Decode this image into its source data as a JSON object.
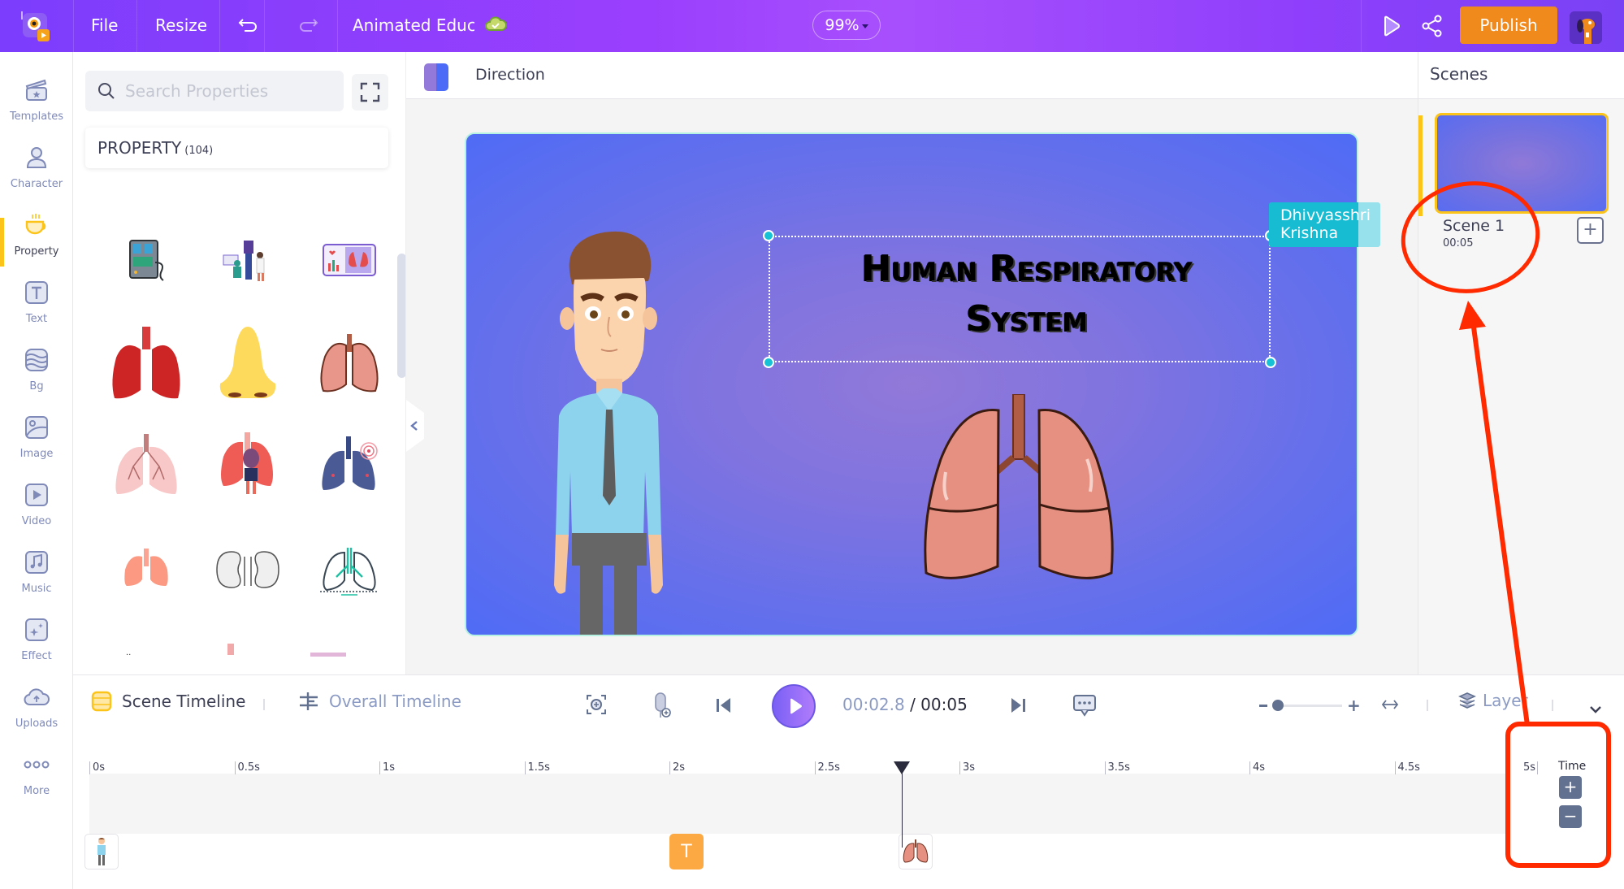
{
  "topbar": {
    "file_label": "File",
    "resize_label": "Resize",
    "project_title": "Animated Educa",
    "zoom_level": "99%",
    "publish_label": "Publish"
  },
  "rail": {
    "items": [
      {
        "label": "Templates",
        "icon": "clapperboard-star-icon"
      },
      {
        "label": "Character",
        "icon": "person-icon"
      },
      {
        "label": "Property",
        "icon": "coffee-cup-icon",
        "active": true
      },
      {
        "label": "Text",
        "icon": "text-t-icon"
      },
      {
        "label": "Bg",
        "icon": "layers-wave-icon"
      },
      {
        "label": "Image",
        "icon": "image-icon"
      },
      {
        "label": "Video",
        "icon": "play-square-icon"
      },
      {
        "label": "Music",
        "icon": "music-note-icon"
      },
      {
        "label": "Effect",
        "icon": "sparkle-icon"
      },
      {
        "label": "Uploads",
        "icon": "cloud-upload-icon"
      },
      {
        "label": "More",
        "icon": "more-dots-icon"
      }
    ]
  },
  "panel": {
    "search_placeholder": "Search Properties",
    "section_title": "PROPERTY",
    "section_count": "(104)",
    "assets": [
      "ventilator-machine",
      "doctors-xray-scene",
      "lungs-report-screen",
      "red-lungs",
      "yellow-nose",
      "detailed-lungs",
      "pink-bronchial-lungs",
      "person-in-lungs",
      "blue-lungs-target",
      "salmon-lungs",
      "sketched-kidneys",
      "outline-lungs-teal"
    ]
  },
  "stage": {
    "direction_label": "Direction",
    "title_line1": "Human Respiratory",
    "title_line2": "System",
    "collaborator_tag": "Dhivyasshri Krishna"
  },
  "scenes": {
    "header": "Scenes",
    "items": [
      {
        "name": "Scene 1",
        "duration": "00:05"
      }
    ]
  },
  "timeline": {
    "scene_tab": "Scene Timeline",
    "overall_tab": "Overall Timeline",
    "current_time": "00:02.8",
    "separator": " / ",
    "total_time": "00:05",
    "layer_label": "Layer",
    "time_label": "Time",
    "zoom_slider_value": 0.05,
    "playhead_seconds": 2.8,
    "ruler": [
      "0s",
      "0.5s",
      "1s",
      "1.5s",
      "2s",
      "2.5s",
      "3s",
      "3.5s",
      "4s",
      "4.5s",
      "5s"
    ],
    "layers": [
      {
        "type": "character",
        "start_seconds": 0
      },
      {
        "type": "text",
        "start_seconds": 2.0,
        "glyph": "T"
      },
      {
        "type": "property",
        "start_seconds": 2.8
      }
    ]
  },
  "colors": {
    "topbar_accent": "#9a3ffd",
    "publish": "#f08a1d",
    "active_indicator": "#fcc419",
    "selection_handle": "#16c1d5",
    "annotation_red": "#ff2a00"
  }
}
